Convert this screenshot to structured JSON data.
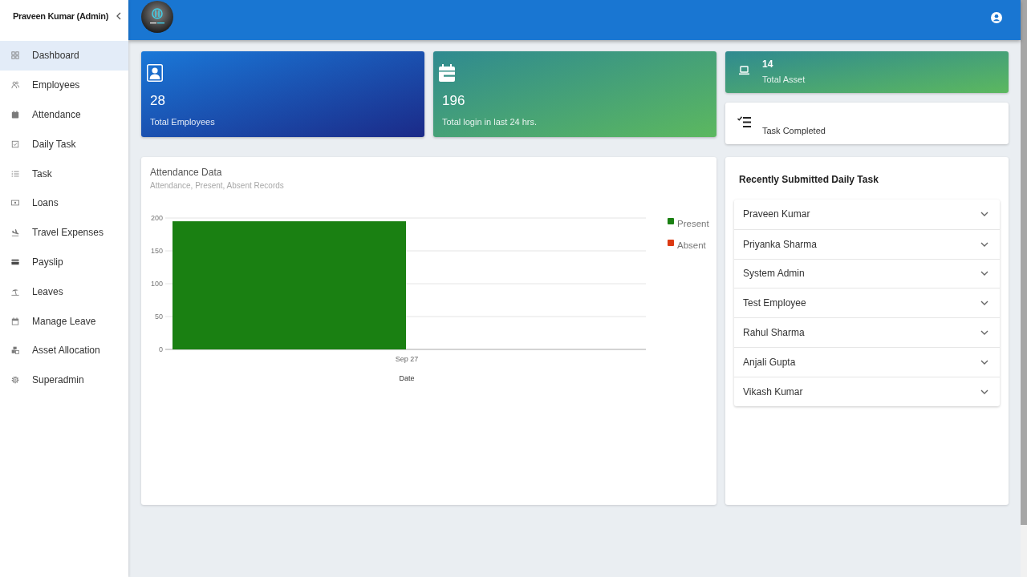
{
  "sidebar": {
    "title": "Praveen Kumar (Admin)",
    "items": [
      {
        "label": "Dashboard",
        "selected": true
      },
      {
        "label": "Employees",
        "selected": false
      },
      {
        "label": "Attendance",
        "selected": false
      },
      {
        "label": "Daily Task",
        "selected": false
      },
      {
        "label": "Task",
        "selected": false
      },
      {
        "label": "Loans",
        "selected": false
      },
      {
        "label": "Travel Expenses",
        "selected": false
      },
      {
        "label": "Payslip",
        "selected": false
      },
      {
        "label": "Leaves",
        "selected": false
      },
      {
        "label": "Manage Leave",
        "selected": false
      },
      {
        "label": "Asset Allocation",
        "selected": false
      },
      {
        "label": "Superadmin",
        "selected": false
      }
    ]
  },
  "summary_cards": [
    {
      "value": "28",
      "label": "Total Employees"
    },
    {
      "value": "196",
      "label": "Total login in last 24 hrs."
    }
  ],
  "side_cards": [
    {
      "kind": "highlight",
      "value": "14",
      "label": "Total Asset"
    },
    {
      "kind": "plain",
      "label": "Task Completed"
    }
  ],
  "attendance_card": {
    "title": "Attendance Data",
    "subtitle": "Attendance, Present, Absent Records",
    "chart_data": {
      "type": "bar",
      "xlabel": "Date",
      "categories": [
        "Sep 27"
      ],
      "series": [
        {
          "name": "Present",
          "color": "#1a8012",
          "values": [
            195
          ]
        },
        {
          "name": "Absent",
          "color": "#dc3912",
          "values": [
            0
          ]
        }
      ],
      "ylim": [
        0,
        200
      ],
      "yticks": [
        0,
        50,
        100,
        150,
        200
      ],
      "grid": true
    }
  },
  "recent_tasks": {
    "title": "Recently Submitted Daily Task",
    "items": [
      {
        "name": "Praveen Kumar",
        "expanded": false
      },
      {
        "name": "Priyanka Sharma",
        "expanded": false
      },
      {
        "name": "System Admin",
        "expanded": false
      },
      {
        "name": "Test Employee",
        "expanded": false
      },
      {
        "name": "Rahul Sharma",
        "expanded": false
      },
      {
        "name": "Anjali Gupta",
        "expanded": false
      },
      {
        "name": "Vikash Kumar",
        "expanded": false
      }
    ]
  }
}
